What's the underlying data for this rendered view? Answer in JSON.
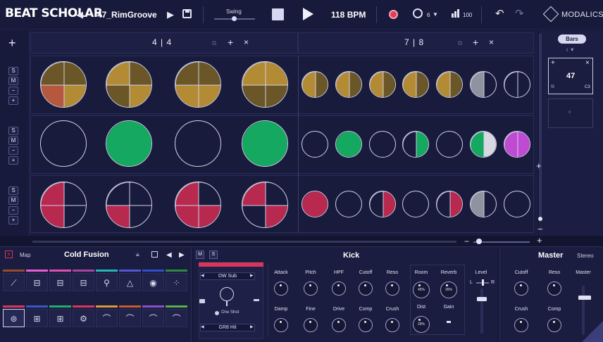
{
  "app": {
    "logo": "BEAT SCHOLAR",
    "brand": "MODALICS"
  },
  "topbar": {
    "preset_name": "47_RimGroove",
    "swing_label": "Swing",
    "swing_value": 0.5,
    "bpm_value": "118",
    "bpm_unit": "BPM",
    "quantize_value": "6",
    "velocity_value": "100"
  },
  "sequencer": {
    "section1_time_signature": {
      "top": "4",
      "bottom": "4"
    },
    "section2_time_signature": {
      "top": "7",
      "bottom": "8"
    },
    "row_buttons": [
      "S",
      "M",
      "−",
      "+"
    ]
  },
  "pattern_panel": {
    "bars_label": "Bars",
    "pattern_number": "47",
    "pattern_tag": "C3"
  },
  "kit": {
    "map_label": "Map",
    "kit_name": "Cold Fusion"
  },
  "instrument": {
    "tab_m": "M",
    "tab_s": "S",
    "title": "Kick",
    "sample_top": "DW Sub",
    "oneshot_label": "One Shot",
    "sample_bottom": "GR8 Hit",
    "params": {
      "attack": "Attack",
      "pitch": "Pitch",
      "hpf": "HPF",
      "cutoff": "Cutoff",
      "reso": "Reso",
      "damp": "Damp",
      "fine": "Fine",
      "drive": "Drive",
      "comp": "Comp",
      "crush": "Crush"
    },
    "fx": {
      "room": "Room",
      "room_value": "45%",
      "reverb": "Reverb",
      "reverb_value": "26%",
      "dist": "Dist",
      "dist_value": "29%",
      "gain": "Gain"
    },
    "level_label": "Level",
    "level_l": "L",
    "level_r": "R"
  },
  "master": {
    "title": "Master",
    "stereo": "Stereo",
    "cutoff": "Cutoff",
    "reso": "Reso",
    "crush": "Crush",
    "comp": "Comp",
    "master_label": "Master"
  },
  "colors": {
    "gold": "#b48b35",
    "gold_dark": "#6b5627",
    "orange_red": "#b5583d",
    "green": "#15a860",
    "crimson": "#b7294f",
    "magenta": "#c04bd3",
    "gray": "#8f929f",
    "light_gray": "#d6d8e2"
  }
}
